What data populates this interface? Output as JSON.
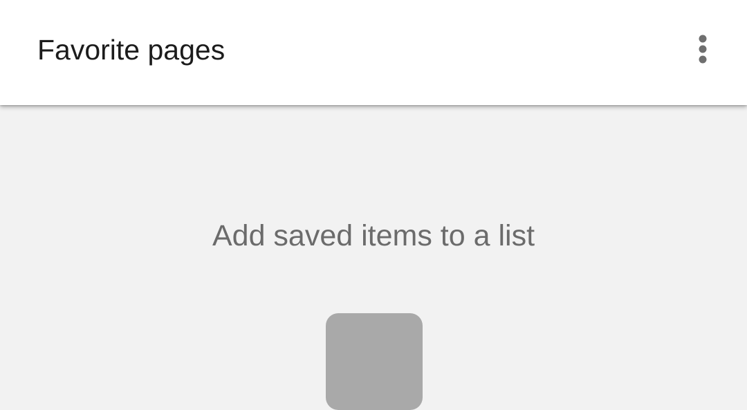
{
  "app_bar": {
    "title": "Favorite pages",
    "menu_icon": "more-vert-icon"
  },
  "empty_state": {
    "message": "Add saved items to a list",
    "illustration_icon": "placeholder-tile-icon"
  },
  "colors": {
    "app_bar_background": "#ffffff",
    "page_background": "#f2f2f2",
    "title_text": "#1c1c1c",
    "message_text": "#6b6b6b",
    "icon_gray": "#6f6f6f",
    "tile_gray": "#a9a9a9"
  }
}
